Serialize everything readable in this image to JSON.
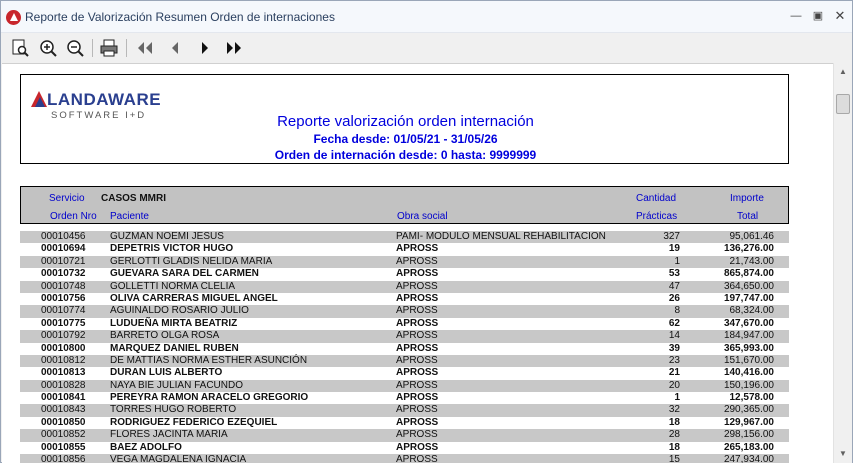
{
  "window": {
    "title": "Reporte de Valorización Resumen Orden de internaciones",
    "controls": [
      "minimize",
      "maximize",
      "close"
    ]
  },
  "toolbar": {
    "buttons": [
      {
        "name": "page-setup",
        "icon": "page-preview-icon"
      },
      {
        "name": "zoom-in",
        "icon": "zoom-in-icon"
      },
      {
        "name": "zoom-out",
        "icon": "zoom-out-icon"
      },
      {
        "name": "print",
        "icon": "printer-icon"
      },
      {
        "name": "first-page",
        "icon": "first-page-icon"
      },
      {
        "name": "prev-page",
        "icon": "prev-page-icon"
      },
      {
        "name": "next-page",
        "icon": "next-page-icon"
      },
      {
        "name": "last-page",
        "icon": "last-page-icon"
      }
    ]
  },
  "report": {
    "logo_name": "LANDAWARE",
    "logo_sub": "SOFTWARE I+D",
    "title": "Reporte valorización orden internación",
    "date_range": "Fecha desde: 01/05/21 - 31/05/26",
    "order_range": "Orden de internación desde: 0 hasta: 9999999",
    "colors": {
      "title": "#0000dd",
      "header_bg": "#c2c2c2",
      "row_shade": "#c8c8c8",
      "brand_red": "#c8262c",
      "brand_blue": "#2a3f8f"
    }
  },
  "columns": {
    "servicio_label": "Servicio",
    "servicio_value": "CASOS MMRI",
    "cantidad_label": "Cantidad",
    "importe_label": "Importe",
    "orden_label": "Orden Nro",
    "paciente_label": "Paciente",
    "obra_label": "Obra social",
    "practicas_label": "Prácticas",
    "total_label": "Total"
  },
  "rows": [
    {
      "nro": "00010456",
      "paciente": "GUZMAN NOEMI JESUS",
      "obra": "PAMI- MODULO MENSUAL REHABILITACION",
      "cant": "327",
      "importe": "95,061.46"
    },
    {
      "nro": "00010694",
      "paciente": "DEPETRIS VICTOR HUGO",
      "obra": "APROSS",
      "cant": "19",
      "importe": "136,276.00"
    },
    {
      "nro": "00010721",
      "paciente": "GERLOTTI GLADIS NELIDA MARIA",
      "obra": "APROSS",
      "cant": "1",
      "importe": "21,743.00"
    },
    {
      "nro": "00010732",
      "paciente": "GUEVARA SARA DEL CARMEN",
      "obra": "APROSS",
      "cant": "53",
      "importe": "865,874.00"
    },
    {
      "nro": "00010748",
      "paciente": "GOLLETTI NORMA CLELIA",
      "obra": "APROSS",
      "cant": "47",
      "importe": "364,650.00"
    },
    {
      "nro": "00010756",
      "paciente": "OLIVA CARRERAS MIGUEL ANGEL",
      "obra": "APROSS",
      "cant": "26",
      "importe": "197,747.00"
    },
    {
      "nro": "00010774",
      "paciente": "AGUINALDO ROSARIO JULIO",
      "obra": "APROSS",
      "cant": "8",
      "importe": "68,324.00"
    },
    {
      "nro": "00010775",
      "paciente": "LUDUEÑA MIRTA BEATRIZ",
      "obra": "APROSS",
      "cant": "62",
      "importe": "347,670.00"
    },
    {
      "nro": "00010792",
      "paciente": "BARRETO OLGA ROSA",
      "obra": "APROSS",
      "cant": "14",
      "importe": "184,947.00"
    },
    {
      "nro": "00010800",
      "paciente": "MARQUEZ DANIEL RUBEN",
      "obra": "APROSS",
      "cant": "39",
      "importe": "365,993.00"
    },
    {
      "nro": "00010812",
      "paciente": "DE MATTIAS NORMA ESTHER ASUNCIÓN",
      "obra": "APROSS",
      "cant": "23",
      "importe": "151,670.00"
    },
    {
      "nro": "00010813",
      "paciente": "DURAN LUIS ALBERTO",
      "obra": "APROSS",
      "cant": "21",
      "importe": "140,416.00"
    },
    {
      "nro": "00010828",
      "paciente": "NAYA BIE JULIAN FACUNDO",
      "obra": "APROSS",
      "cant": "20",
      "importe": "150,196.00"
    },
    {
      "nro": "00010841",
      "paciente": "PEREYRA RAMON ARACELO GREGORIO",
      "obra": "APROSS",
      "cant": "1",
      "importe": "12,578.00"
    },
    {
      "nro": "00010843",
      "paciente": "TORRES HUGO ROBERTO",
      "obra": "APROSS",
      "cant": "32",
      "importe": "290,365.00"
    },
    {
      "nro": "00010850",
      "paciente": "RODRIGUEZ FEDERICO EZEQUIEL",
      "obra": "APROSS",
      "cant": "18",
      "importe": "129,967.00"
    },
    {
      "nro": "00010852",
      "paciente": "FLORES JACINTA MARIA",
      "obra": "APROSS",
      "cant": "28",
      "importe": "298,156.00"
    },
    {
      "nro": "00010855",
      "paciente": "BAEZ ADOLFO",
      "obra": "APROSS",
      "cant": "18",
      "importe": "265,183.00"
    },
    {
      "nro": "00010856",
      "paciente": "VEGA MAGDALENA IGNACIA",
      "obra": "APROSS",
      "cant": "15",
      "importe": "247,934.00"
    }
  ]
}
